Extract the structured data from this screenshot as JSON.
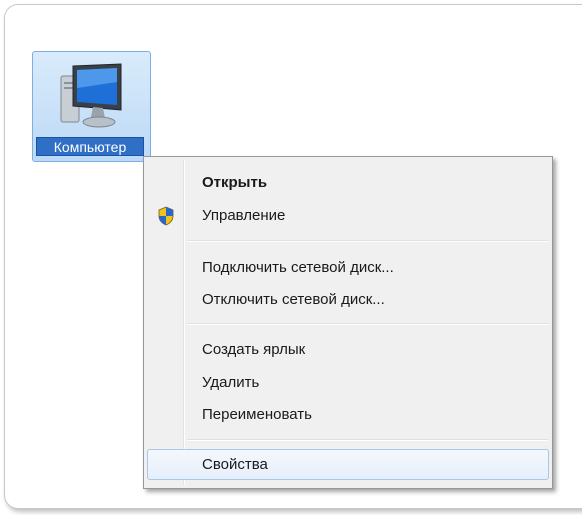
{
  "desktop": {
    "icon_label": "Компьютер",
    "icon_name": "computer-icon"
  },
  "context_menu": {
    "items": [
      {
        "label": "Открыть",
        "bold": true
      },
      {
        "label": "Управление",
        "icon": "uac-shield-icon"
      },
      {
        "label": "Подключить сетевой диск..."
      },
      {
        "label": "Отключить сетевой диск..."
      },
      {
        "label": "Создать ярлык"
      },
      {
        "label": "Удалить"
      },
      {
        "label": "Переименовать"
      },
      {
        "label": "Свойства",
        "highlighted": true
      }
    ]
  },
  "colors": {
    "selection_blue": "#2f6fc6",
    "menu_background": "#f0f0f0",
    "hover_border": "#a8c8ec"
  }
}
